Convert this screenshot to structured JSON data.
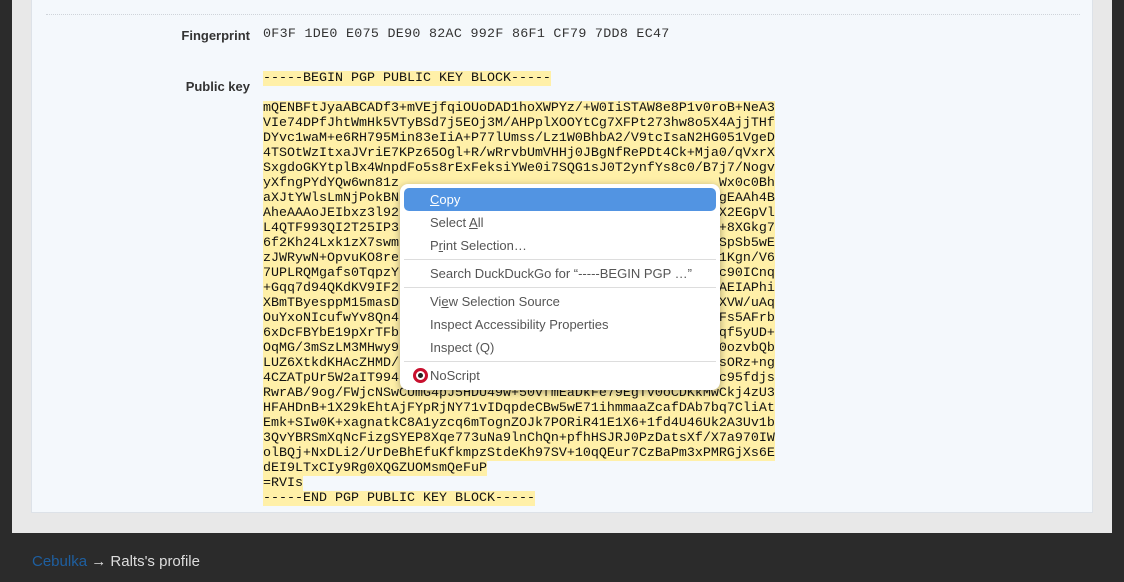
{
  "profile": {
    "fingerprint_label": "Fingerprint",
    "fingerprint": "0F3F 1DE0 E075 DE90 82AC 992F 86F1 CF79 7DD8 EC47",
    "public_key_label": "Public key",
    "key_begin": "-----BEGIN PGP PUBLIC KEY BLOCK-----",
    "key_lines": [
      "mQENBFtJyaABCADf3+mVEjfqiOUoDAD1hoXWPYz/+W0IiSTAW8e8P1v0roB+NeA3",
      "VIe74DPfJhtWmHk5VTyBSd7j5EOj3M/AHPplXOOYtCg7XFPt273hw8o5X4AjjTHf",
      "DYvc1waM+e6RH795Min83eIiA+P77lUmss/Lz1W0BhbA2/V9tcIsaN2HG051VgeD",
      "4TSOtWzItxaJVriE7KPz65Ogl+R/wRrvbUmVHHj0JBgNfRePDt4Ck+Mja0/qVxrX",
      "SxgdoGKYtplBx4WnpdFo5s8rExFeksiYWe0i7SQG1sJ0T2ynfYs8c0/B7j7/Nogv",
      [
        "yXfngPYdYQw6wn81z",
        "Wx0c0Bh"
      ],
      [
        "aXJtYWlsLmNjPokBN",
        "gEAAh4B"
      ],
      [
        "AheAAAoJEIbxz3l92",
        "X2EGpVl"
      ],
      [
        "L4QTF993QI2T25IP3",
        "+8XGkg7"
      ],
      [
        "6f2Kh24Lxk1zX7swm",
        "SpSb5wE"
      ],
      [
        "zJWRywN+OpvuKO8re",
        "1Kgn/V6"
      ],
      [
        "7UPLRQMgafs0TqpzY",
        "c90ICnq"
      ],
      [
        "+Gqq7d94QKdKV9IF2",
        "AEIAPhi"
      ],
      [
        "XBmTByesppM15masD",
        "XVW/uAq"
      ],
      [
        "OuYxoNIcufwYv8Qn4",
        "Fs5AFrb"
      ],
      [
        "6xDcFBYbE19pXrTFb",
        "qf5yUD+"
      ],
      [
        "OqMG/3mSzLM3MHwy9",
        "0ozvbQb"
      ],
      [
        "LUZ6XtkdKHAcZHMD/",
        "sORz+ng"
      ],
      [
        "4CZATpUr5W2aIT994",
        "c95fdjs"
      ],
      "RwrAB/9og/FWjcNSwCUmG4pJ5HDU49w+50vfmEaDkFe79EgTv0oCDKkMwCkj4zU3",
      "HFAHDnB+1X29kEhtAjFYpRjNY71vIDqpdeCBw5wE71ihmmaaZcafDAb7bq7CliAt",
      "Emk+SIw0K+xagnatkC8A1yzcq6mTognZOJk7PORiR41E1X6+1fd4U46Uk2A3Uv1b",
      "3QvYBRSmXqNcFizgSYEP8Xqe773uNa9lnChQn+pfhHSJRJ0PzDatsXf/X7a970IW",
      "olBQj+NxDLi2/UrDeBhEfuKfkmpzStdeKh97SV+10qQEur7CzBaPm3xPMRGjXs6E",
      "dEI9LTxCIy9Rg0XQGZUOMsmQeFuP",
      "=RVIs",
      "-----END PGP PUBLIC KEY BLOCK-----"
    ]
  },
  "footer": {
    "site_link": "Cebulka",
    "arrow": "→",
    "page": "Ralts's profile"
  },
  "context_menu": {
    "items": [
      "Copy",
      "Select All",
      "Print Selection…",
      "Search DuckDuckGo for “-----BEGIN PGP …”",
      "View Selection Source",
      "Inspect Accessibility Properties",
      "Inspect (Q)",
      "NoScript"
    ],
    "active_index": 0,
    "noscript_icon": "noscript-icon"
  },
  "colors": {
    "highlight": "#fff0a8",
    "menu_active": "#5294e2",
    "link": "#1e5fa0"
  }
}
